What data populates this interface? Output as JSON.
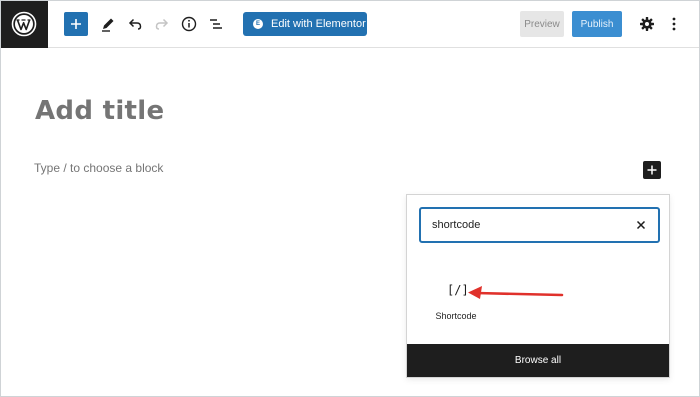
{
  "toolbar": {
    "wordpress_logo_icon": "wordpress-icon",
    "add_block_icon": "plus-icon",
    "tools_icon": "pencil-icon",
    "undo_icon": "undo-icon",
    "redo_icon": "redo-icon",
    "details_icon": "info-icon",
    "list_view_icon": "list-view-icon",
    "elementor_label": "Edit with Elementor",
    "elementor_badge": "E",
    "preview_label": "Preview",
    "publish_label": "Publish",
    "settings_icon": "gear-icon",
    "more_icon": "kebab-icon",
    "accent_color": "#2271b1"
  },
  "editor": {
    "title_placeholder": "Add title",
    "block_hint": "Type / to choose a block",
    "inline_add_icon": "plus-icon"
  },
  "inserter": {
    "search_value": "shortcode",
    "clear_icon": "close-icon",
    "results": [
      {
        "icon": "[/]",
        "label": "Shortcode"
      }
    ],
    "browse_all_label": "Browse all"
  },
  "annotation": {
    "color": "#e0312b"
  }
}
